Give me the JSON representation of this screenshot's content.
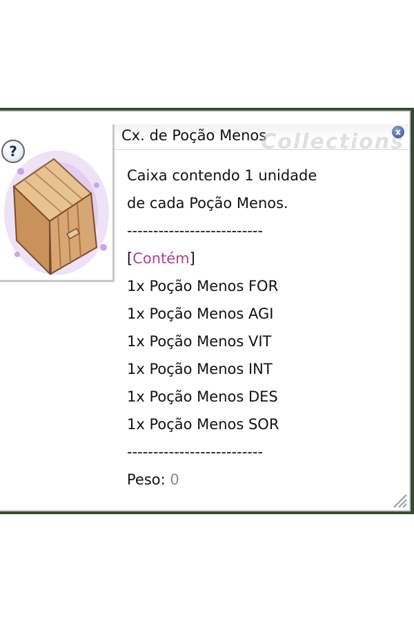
{
  "window": {
    "title": "Cx. de Poção Menos",
    "watermark": "Collections",
    "help_icon": "question-mark-icon",
    "close_icon": "close-icon",
    "help_label": "?",
    "close_label": "x"
  },
  "item": {
    "icon": "wooden-crate-icon",
    "description": [
      "Caixa contendo 1 unidade",
      "de cada Poção Menos."
    ],
    "separator": "--------------------------",
    "contains_open": "[",
    "contains_label": "Contém",
    "contains_close": "]",
    "contents": [
      "1x Poção Menos FOR",
      "1x Poção Menos AGI",
      "1x Poção Menos VIT",
      "1x Poção Menos INT",
      "1x Poção Menos DES",
      "1x Poção Menos SOR"
    ],
    "weight_label": "Peso: ",
    "weight_value": "0"
  },
  "colors": {
    "contains_label": "#b63e8a",
    "weight_value": "#8a8a8a",
    "border": "#c9cdd3"
  }
}
